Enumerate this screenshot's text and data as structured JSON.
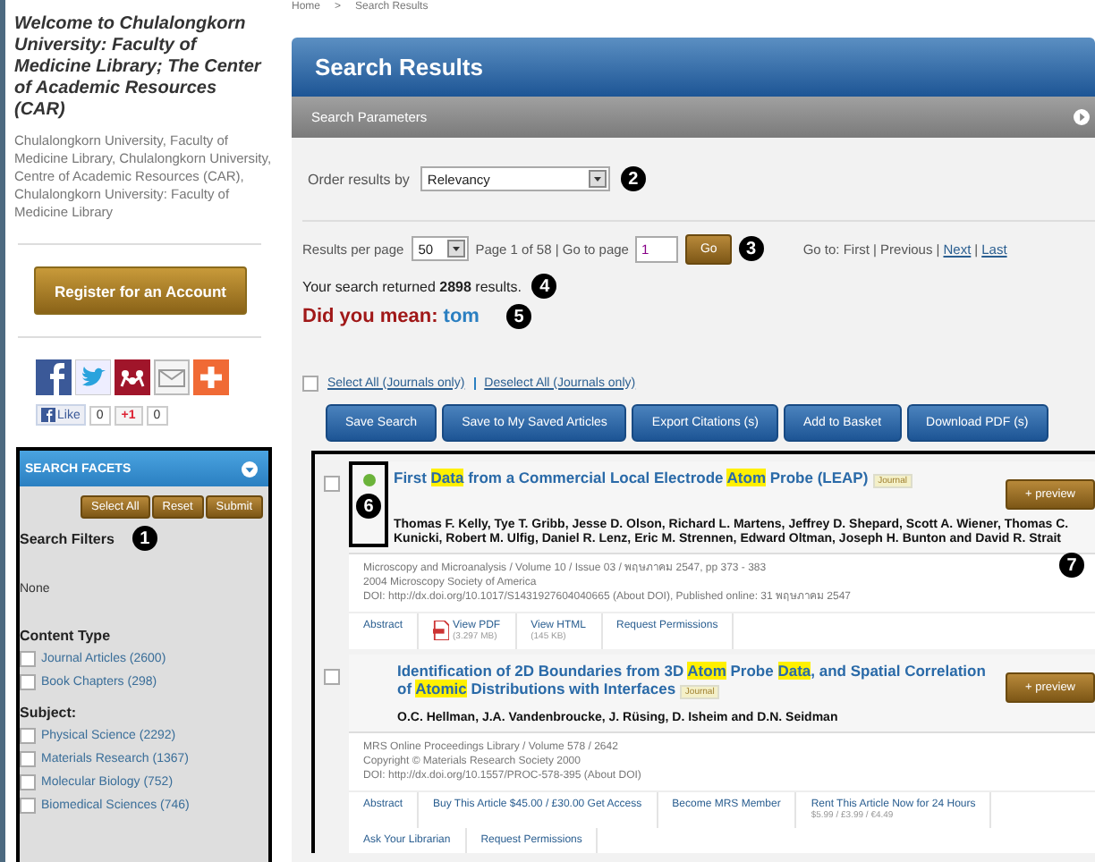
{
  "sidebar": {
    "welcome_title": "Welcome to Chulalongkorn University: Faculty of Medicine Library; The Center of Academic Resources (CAR)",
    "affiliation": "Chulalongkorn University, Faculty of Medicine Library, Chulalongkorn University, Centre of Academic Resources (CAR), Chulalongkorn University: Faculty of Medicine Library",
    "register_button": "Register for an Account",
    "share_icons": [
      {
        "kind": "facebook"
      },
      {
        "kind": "twitter"
      },
      {
        "kind": "mendeley"
      },
      {
        "kind": "email"
      },
      {
        "kind": "plus"
      }
    ],
    "like": {
      "label": "Like",
      "count": "0"
    },
    "plusone": {
      "label": "+1",
      "count": "0"
    },
    "facets": {
      "title": "SEARCH FACETS",
      "buttons": [
        "Select All",
        "Reset",
        "Submit"
      ],
      "callout": "1",
      "filters_heading": "Search Filters",
      "filters_value": "None",
      "groups": [
        {
          "heading": "Content Type",
          "items": [
            {
              "label": "Journal Articles (2600)",
              "checked": false
            },
            {
              "label": "Book Chapters (298)",
              "checked": false
            }
          ]
        },
        {
          "heading": "Subject:",
          "items": [
            {
              "label": "Physical Science (2292)",
              "checked": false
            },
            {
              "label": "Materials Research (1367)",
              "checked": false
            },
            {
              "label": "Molecular Biology (752)",
              "checked": false
            },
            {
              "label": "Biomedical Sciences (746)",
              "checked": false
            }
          ]
        }
      ]
    }
  },
  "breadcrumb": [
    "Home",
    ">",
    "Search Results"
  ],
  "header": {
    "title": "Search Results",
    "parameters": "Search Parameters"
  },
  "order": {
    "label": "Order results by",
    "value": "Relevancy",
    "callout": "2"
  },
  "paging": {
    "per_page_label": "Results per page",
    "per_page": "50",
    "page_text": "Page 1 of 58 | Go to page",
    "page_input": "1",
    "go_button": "Go",
    "callout": "3",
    "nav_prefix": "Go to: First | Previous |",
    "nav_links": [
      "Next",
      "Last"
    ],
    "nav_separator": "|"
  },
  "summary": {
    "text": "Your search returned **2898** results.",
    "callout": "4"
  },
  "suggestion": {
    "label": "Did you mean:",
    "term": "tom",
    "callout": "5"
  },
  "select_all": {
    "checked": false,
    "links": [
      "Select All (Journals only)",
      "Deselect All (Journals only)"
    ]
  },
  "actions": [
    "Save Search",
    "Save to My Saved Articles",
    "Export Citations (s)",
    "Add to Basket",
    "Download PDF (s)"
  ],
  "results": [
    {
      "checked": false,
      "open_access": true,
      "title": [
        {
          "text": "First ",
          "highlight": false
        },
        {
          "text": "Data",
          "highlight": true
        },
        {
          "text": " from a Commercial Local Electrode ",
          "highlight": false
        },
        {
          "text": "Atom",
          "highlight": true
        },
        {
          "text": " Probe (LEAP)",
          "highlight": false
        }
      ],
      "badge": "Journal",
      "preview": "+ preview",
      "callout_frame": "6",
      "callout_side": "7",
      "authors": "Thomas F. Kelly, Tye T. Gribb, Jesse D. Olson, Richard L. Martens, Jeffrey D. Shepard, Scott A. Wiener, Thomas C. Kunicki, Robert M. Ulfig, Daniel R. Lenz, Eric M. Strennen, Edward Oltman, Joseph H. Bunton and David R. Strait",
      "meta": [
        "Microscopy and Microanalysis / Volume 10 / Issue 03 / พฤษภาคม 2547, pp 373 - 383",
        "2004 Microscopy Society of America",
        "DOI: http://dx.doi.org/10.1017/S1431927604040665 (About DOI), Published online: 31 พฤษภาคม 2547"
      ],
      "links": [
        {
          "kind": "text",
          "label": "Abstract"
        },
        {
          "kind": "pdf",
          "label": "View PDF",
          "sub": "(3.297 MB)"
        },
        {
          "kind": "text",
          "label": "View HTML",
          "sub": "(145 KB)"
        },
        {
          "kind": "text",
          "label": "Request Permissions"
        }
      ]
    },
    {
      "checked": false,
      "open_access": false,
      "title": [
        {
          "text": "Identification of 2D Boundaries from 3D ",
          "highlight": false
        },
        {
          "text": "Atom",
          "highlight": true
        },
        {
          "text": " Probe ",
          "highlight": false
        },
        {
          "text": "Data",
          "highlight": true
        },
        {
          "text": ", and Spatial Correlation of ",
          "highlight": false
        },
        {
          "text": "Atomic",
          "highlight": true
        },
        {
          "text": " Distributions with Interfaces",
          "highlight": false
        }
      ],
      "badge": "Journal",
      "preview": "+ preview",
      "authors": "O.C. Hellman, J.A. Vandenbroucke, J. Rüsing, D. Isheim and D.N. Seidman",
      "meta": [
        "MRS Online Proceedings Library / Volume 578 / 2642",
        "Copyright © Materials Research Society 2000",
        "DOI: http://dx.doi.org/10.1557/PROC-578-395 (About DOI)"
      ],
      "links": [
        {
          "kind": "text",
          "label": "Abstract"
        },
        {
          "kind": "text",
          "label": "Buy This Article $45.00 / £30.00 Get Access"
        },
        {
          "kind": "text",
          "label": "Become MRS Member"
        },
        {
          "kind": "text",
          "label": "Rent This Article Now for 24 Hours",
          "sub": "$5.99 / £3.99 / €4.49"
        },
        {
          "kind": "text",
          "label": "Ask Your Librarian"
        },
        {
          "kind": "text",
          "label": "Request Permissions"
        }
      ]
    }
  ]
}
